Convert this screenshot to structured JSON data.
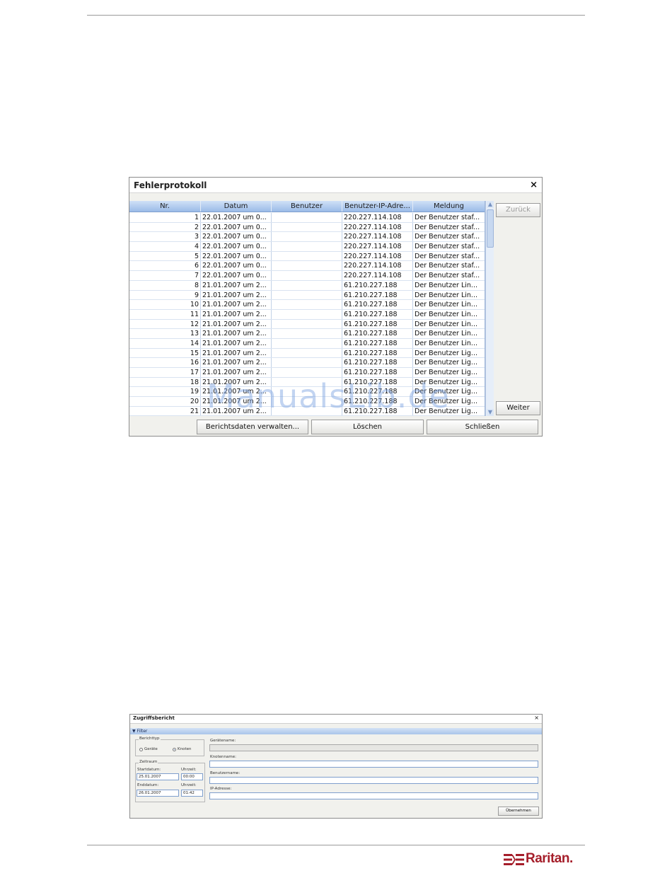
{
  "error_log": {
    "title": "Fehlerprotokoll",
    "close_glyph": "×",
    "columns": [
      "Nr.",
      "Datum",
      "Benutzer",
      "Benutzer-IP-Adre...",
      "Meldung"
    ],
    "rows": [
      [
        "1",
        "22.01.2007 um 0...",
        "",
        "220.227.114.108",
        "Der Benutzer staf..."
      ],
      [
        "2",
        "22.01.2007 um 0...",
        "",
        "220.227.114.108",
        "Der Benutzer staf..."
      ],
      [
        "3",
        "22.01.2007 um 0...",
        "",
        "220.227.114.108",
        "Der Benutzer staf..."
      ],
      [
        "4",
        "22.01.2007 um 0...",
        "",
        "220.227.114.108",
        "Der Benutzer staf..."
      ],
      [
        "5",
        "22.01.2007 um 0...",
        "",
        "220.227.114.108",
        "Der Benutzer staf..."
      ],
      [
        "6",
        "22.01.2007 um 0...",
        "",
        "220.227.114.108",
        "Der Benutzer staf..."
      ],
      [
        "7",
        "22.01.2007 um 0...",
        "",
        "220.227.114.108",
        "Der Benutzer staf..."
      ],
      [
        "8",
        "21.01.2007 um 2...",
        "",
        "61.210.227.188",
        "Der Benutzer Lin..."
      ],
      [
        "9",
        "21.01.2007 um 2...",
        "",
        "61.210.227.188",
        "Der Benutzer Lin..."
      ],
      [
        "10",
        "21.01.2007 um 2...",
        "",
        "61.210.227.188",
        "Der Benutzer Lin..."
      ],
      [
        "11",
        "21.01.2007 um 2...",
        "",
        "61.210.227.188",
        "Der Benutzer Lin..."
      ],
      [
        "12",
        "21.01.2007 um 2...",
        "",
        "61.210.227.188",
        "Der Benutzer Lin..."
      ],
      [
        "13",
        "21.01.2007 um 2...",
        "",
        "61.210.227.188",
        "Der Benutzer Lin..."
      ],
      [
        "14",
        "21.01.2007 um 2...",
        "",
        "61.210.227.188",
        "Der Benutzer Lin..."
      ],
      [
        "15",
        "21.01.2007 um 2...",
        "",
        "61.210.227.188",
        "Der Benutzer Lig..."
      ],
      [
        "16",
        "21.01.2007 um 2...",
        "",
        "61.210.227.188",
        "Der Benutzer Lig..."
      ],
      [
        "17",
        "21.01.2007 um 2...",
        "",
        "61.210.227.188",
        "Der Benutzer Lig..."
      ],
      [
        "18",
        "21.01.2007 um 2...",
        "",
        "61.210.227.188",
        "Der Benutzer Lig..."
      ],
      [
        "19",
        "21.01.2007 um 2...",
        "",
        "61.210.227.188",
        "Der Benutzer Lig..."
      ],
      [
        "20",
        "21.01.2007 um 2...",
        "",
        "61.210.227.188",
        "Der Benutzer Lig..."
      ],
      [
        "21",
        "21.01.2007 um 2...",
        "",
        "61.210.227.188",
        "Der Benutzer Lig..."
      ]
    ],
    "buttons": {
      "back": "Zurück",
      "next": "Weiter",
      "manage": "Berichtsdaten verwalten...",
      "delete": "Löschen",
      "close": "Schließen"
    },
    "scroll_up_glyph": "▲",
    "scroll_down_glyph": "▼"
  },
  "watermark": "ManualsLib.de",
  "access_report": {
    "title": "Zugriffsbericht",
    "close_glyph": "×",
    "filter_label": "▼ Filter",
    "report_type_label": "Berichttyp",
    "radio_devices": "Geräte",
    "radio_nodes": "Knoten",
    "selected_type": "Knoten",
    "period_label": "Zeitraum",
    "start_date_label": "Startdatum:",
    "start_time_label": "Uhrzeit:",
    "start_date": "25.01.2007",
    "start_time": "00:00",
    "end_date_label": "Enddatum:",
    "end_time_label": "Uhrzeit:",
    "end_date": "26.01.2007",
    "end_time": "01:42",
    "device_name_label": "Gerätename:",
    "node_name_label": "Knotenname:",
    "user_name_label": "Benutzername:",
    "ip_label": "IP-Adresse:",
    "apply_button": "Übernehmen"
  },
  "logo": {
    "text": "Raritan.",
    "color": "#a51e2a",
    "icon": "raritan-logo-mark-icon"
  },
  "colors": {
    "grid_header": "#9bbbe8",
    "watermark": "#78a0e1"
  }
}
